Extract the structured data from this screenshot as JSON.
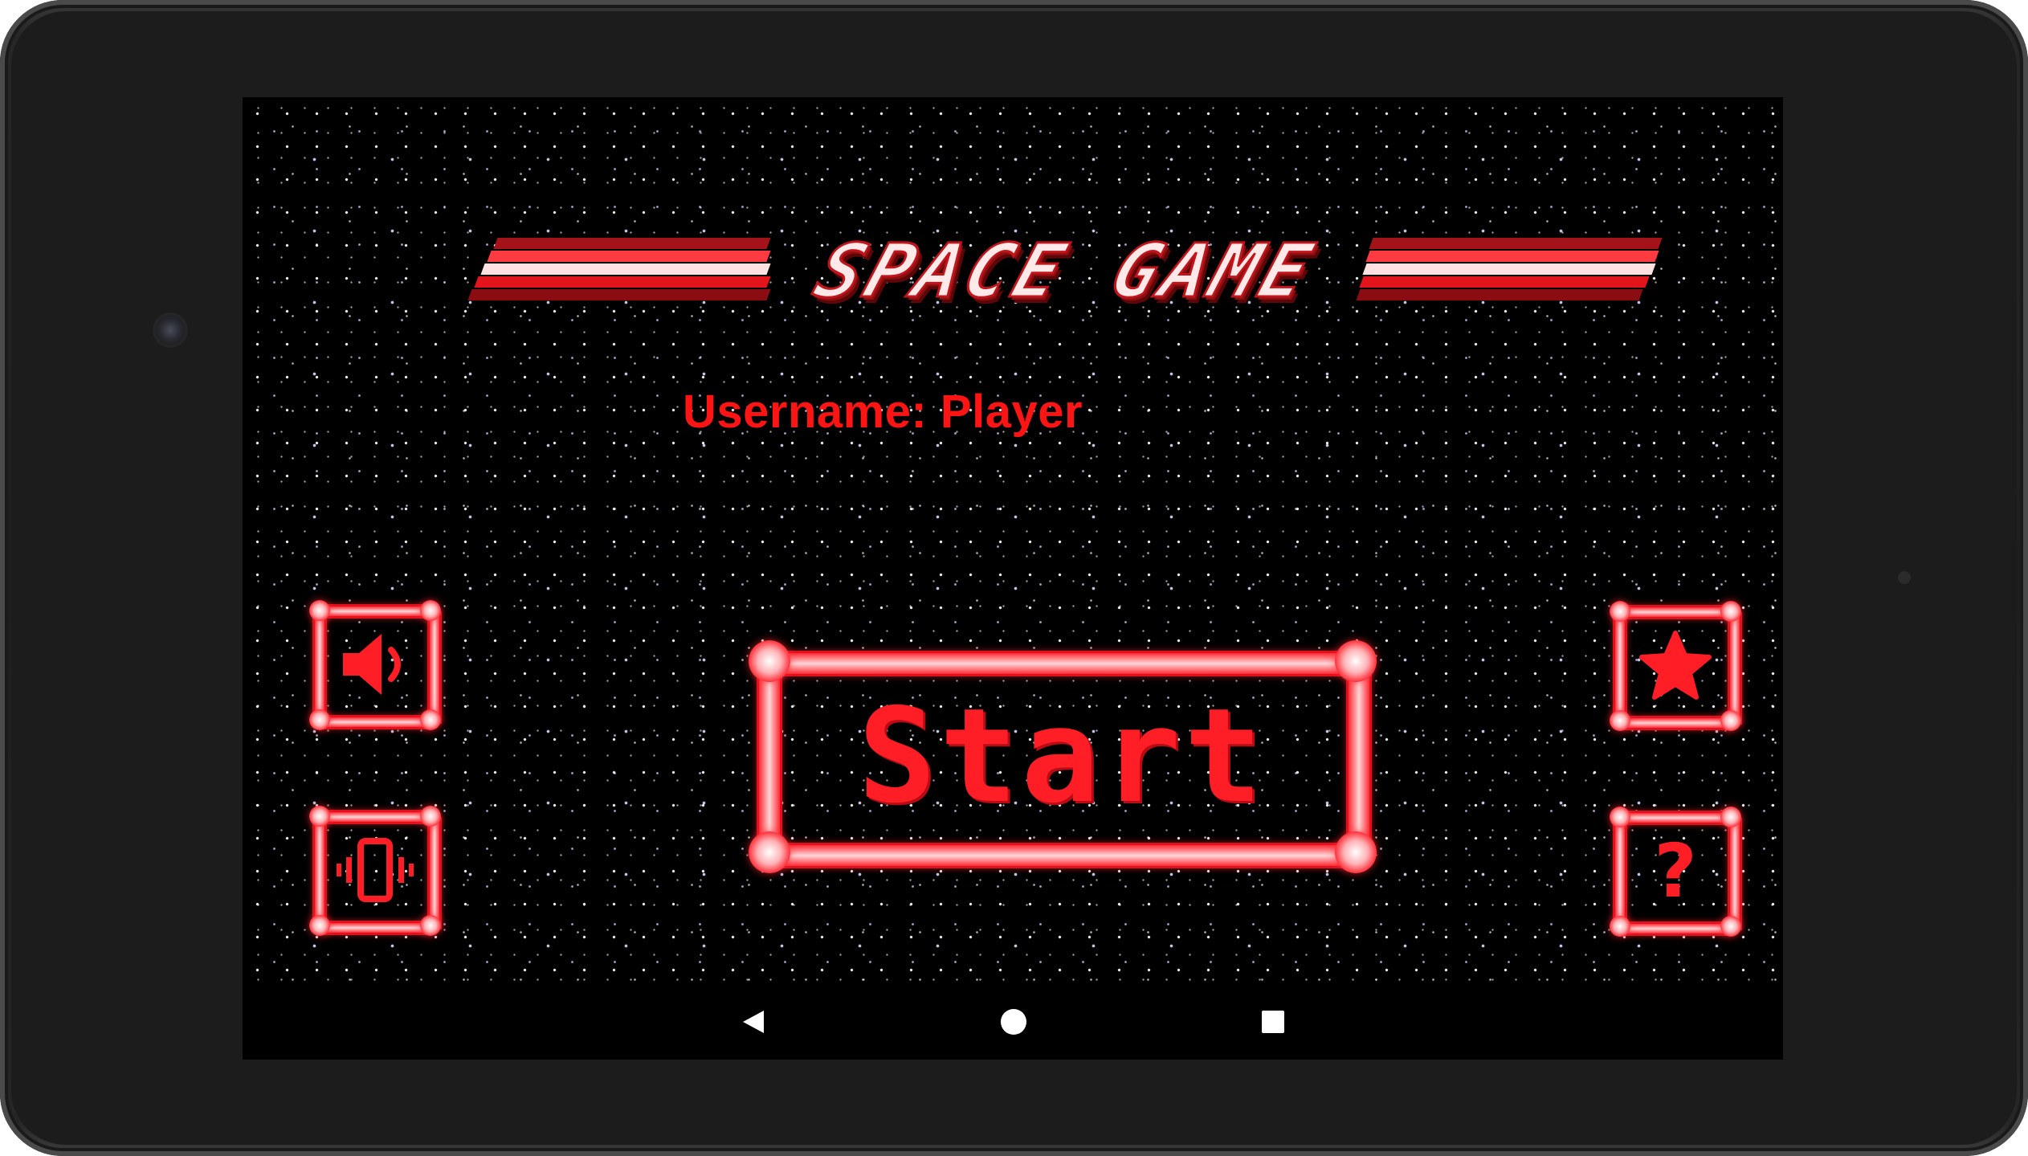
{
  "game": {
    "title": "SPACE GAME",
    "username_text": "Username: Player",
    "start_label": "Start",
    "help_glyph": "?"
  },
  "buttons": {
    "sound": {
      "icon": "speaker-icon"
    },
    "vibration": {
      "icon": "vibrate-phone-icon"
    },
    "rate": {
      "icon": "star-icon"
    },
    "help": {
      "icon": "question-mark-icon"
    }
  },
  "navigation": {
    "back": {
      "icon": "triangle-back-icon"
    },
    "home": {
      "icon": "circle-home-icon"
    },
    "recents": {
      "icon": "square-recents-icon"
    }
  },
  "colors": {
    "accent_red": "#ff1d26",
    "neon_highlight": "#ffd6d8",
    "background": "#000000",
    "bezel": "#1e1e1e"
  }
}
